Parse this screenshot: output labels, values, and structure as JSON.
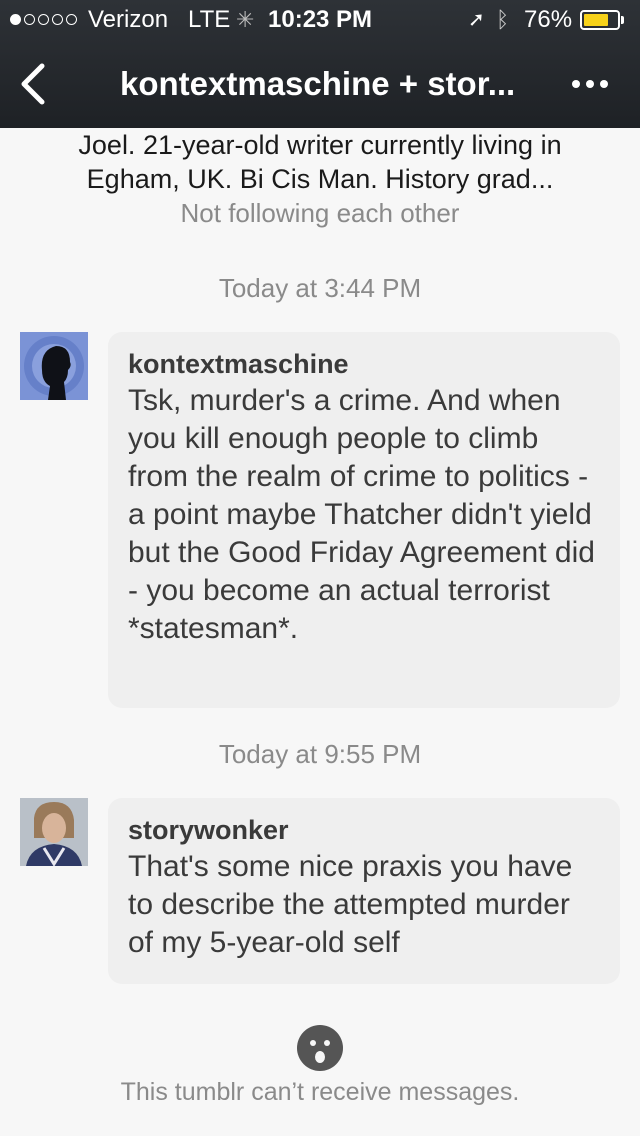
{
  "status_bar": {
    "signal_dots": 5,
    "signal_strength": 1,
    "carrier": "Verizon",
    "network": "LTE",
    "time": "10:23 PM",
    "battery_percent": "76%",
    "battery_level": 0.76,
    "battery_color": "#f7d21a"
  },
  "nav": {
    "title": "kontextmaschine + stor...",
    "back_icon": "chevron-left-icon",
    "more_icon": "ellipsis-icon"
  },
  "header": {
    "bio": "Joel. 21-year-old writer currently living in Egham, UK. Bi Cis Man. History grad...",
    "relation": "Not following each other"
  },
  "messages": [
    {
      "timestamp": "Today at 3:44 PM",
      "username": "kontextmaschine",
      "avatar": "silhouette-avatar",
      "text": "Tsk, murder's a crime. And when you kill enough people to climb from the realm of crime to politics - a point maybe Thatcher didn't yield but the Good Friday Agreement did - you become an actual terrorist *statesman*."
    },
    {
      "timestamp": "Today at 9:55 PM",
      "username": "storywonker",
      "avatar": "portrait-avatar",
      "text": "That's some nice praxis you have to describe the attempted murder of my 5-year-old self"
    }
  ],
  "footer": {
    "icon": "sad-face-icon",
    "notice": "This tumblr can’t receive messages."
  }
}
